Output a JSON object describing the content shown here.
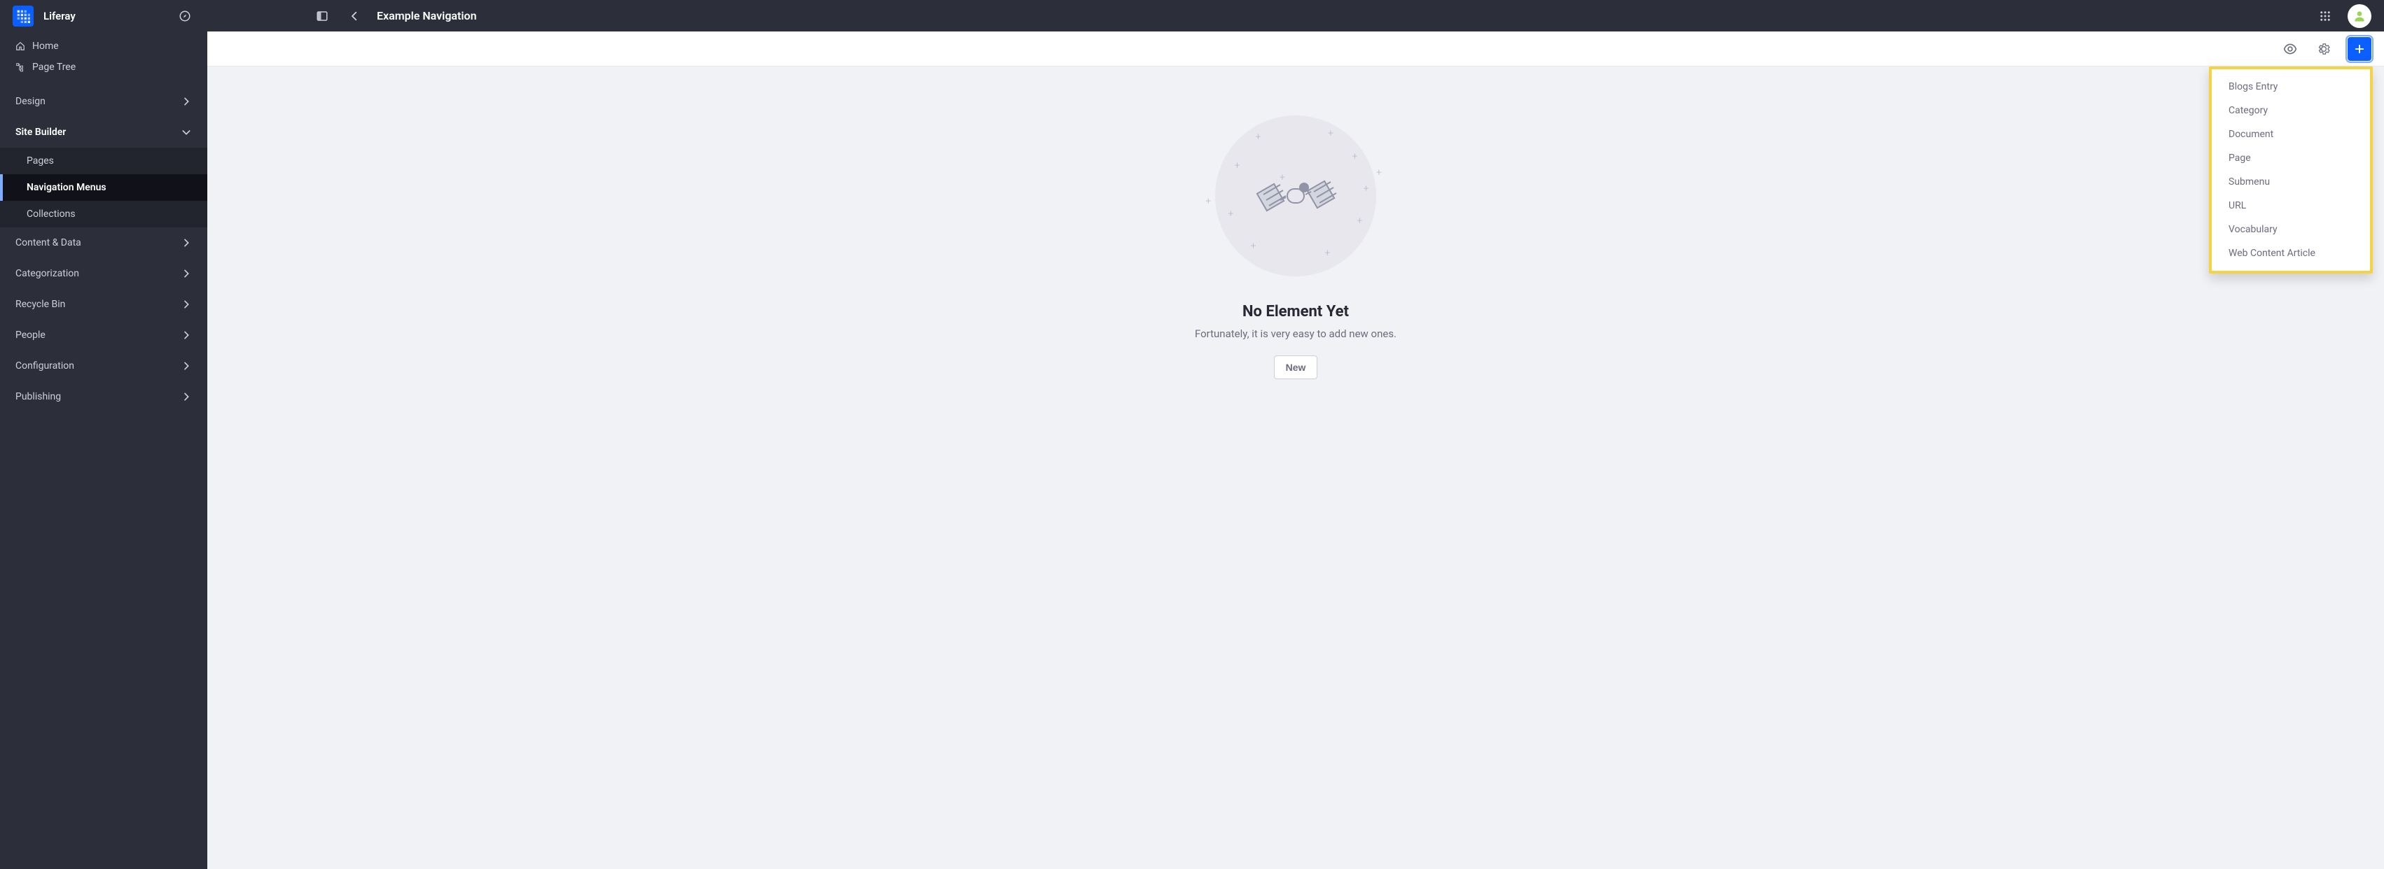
{
  "brand": {
    "name": "Liferay"
  },
  "header": {
    "title": "Example Navigation"
  },
  "sidebar": {
    "home": "Home",
    "page_tree": "Page Tree",
    "design": "Design",
    "site_builder": "Site Builder",
    "site_builder_items": {
      "pages": "Pages",
      "navigation_menus": "Navigation Menus",
      "collections": "Collections"
    },
    "content_data": "Content & Data",
    "categorization": "Categorization",
    "recycle_bin": "Recycle Bin",
    "people": "People",
    "configuration": "Configuration",
    "publishing": "Publishing"
  },
  "empty": {
    "title": "No Element Yet",
    "subtitle": "Fortunately, it is very easy to add new ones.",
    "new_button": "New"
  },
  "dropdown": {
    "items": [
      "Blogs Entry",
      "Category",
      "Document",
      "Page",
      "Submenu",
      "URL",
      "Vocabulary",
      "Web Content Article"
    ]
  }
}
